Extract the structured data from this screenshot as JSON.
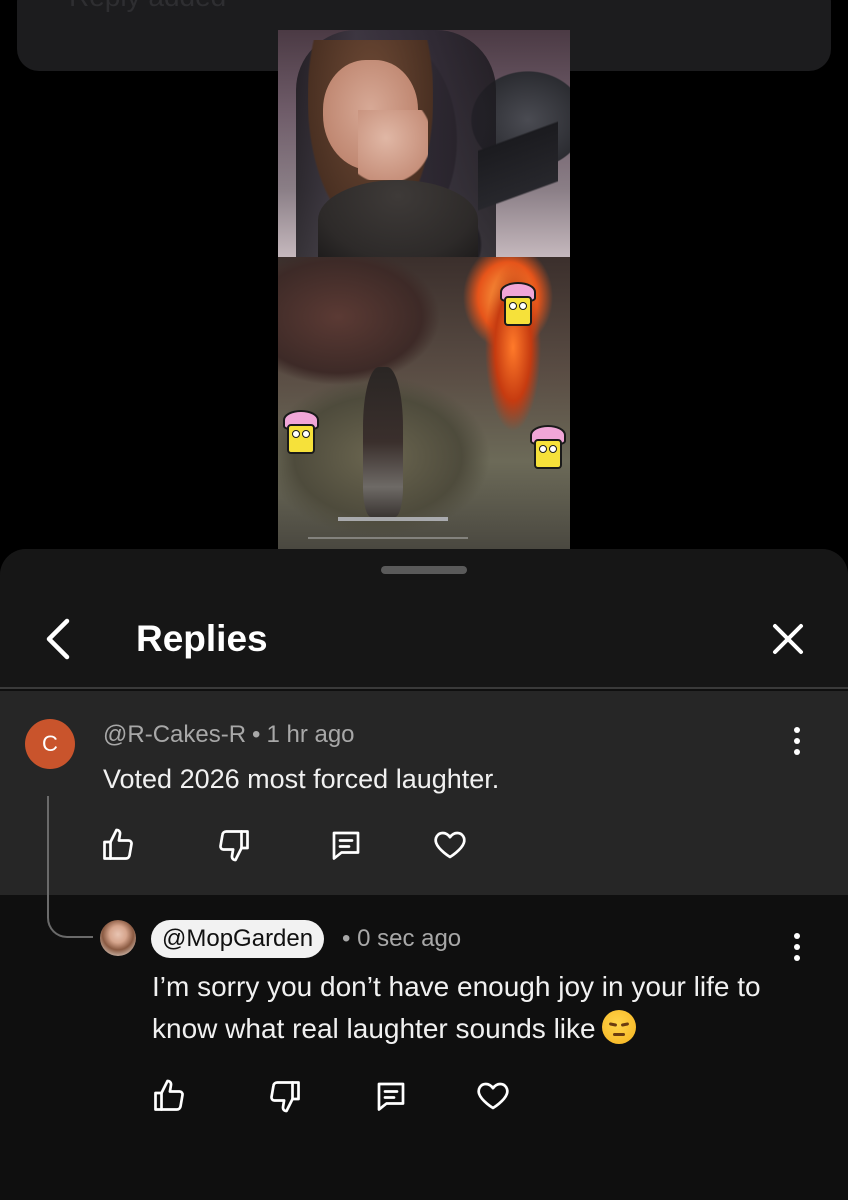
{
  "toast": {
    "text": "Reply added"
  },
  "header": {
    "title": "Replies"
  },
  "parent_comment": {
    "avatar_letter": "C",
    "avatar_color": "#c9542c",
    "author": "@R-Cakes-R",
    "separator": "•",
    "time": "1 hr ago",
    "text": "Voted 2026 most forced laughter."
  },
  "reply": {
    "author": "@MopGarden",
    "separator": "•",
    "time": "0 sec ago",
    "text": "I’m sorry you don’t have enough joy in your life to know what real laughter sounds like",
    "emoji": "pensive-face-emoji"
  },
  "icons": {
    "back": "chevron-left-icon",
    "close": "close-icon",
    "more": "more-vertical-icon",
    "like": "thumbs-up-icon",
    "dislike": "thumbs-down-icon",
    "reply": "comment-icon",
    "heart": "heart-icon"
  },
  "colors": {
    "sheet_bg": "#0f0f0f",
    "parent_bg": "#262626",
    "muted_text": "#a8a8a8"
  }
}
